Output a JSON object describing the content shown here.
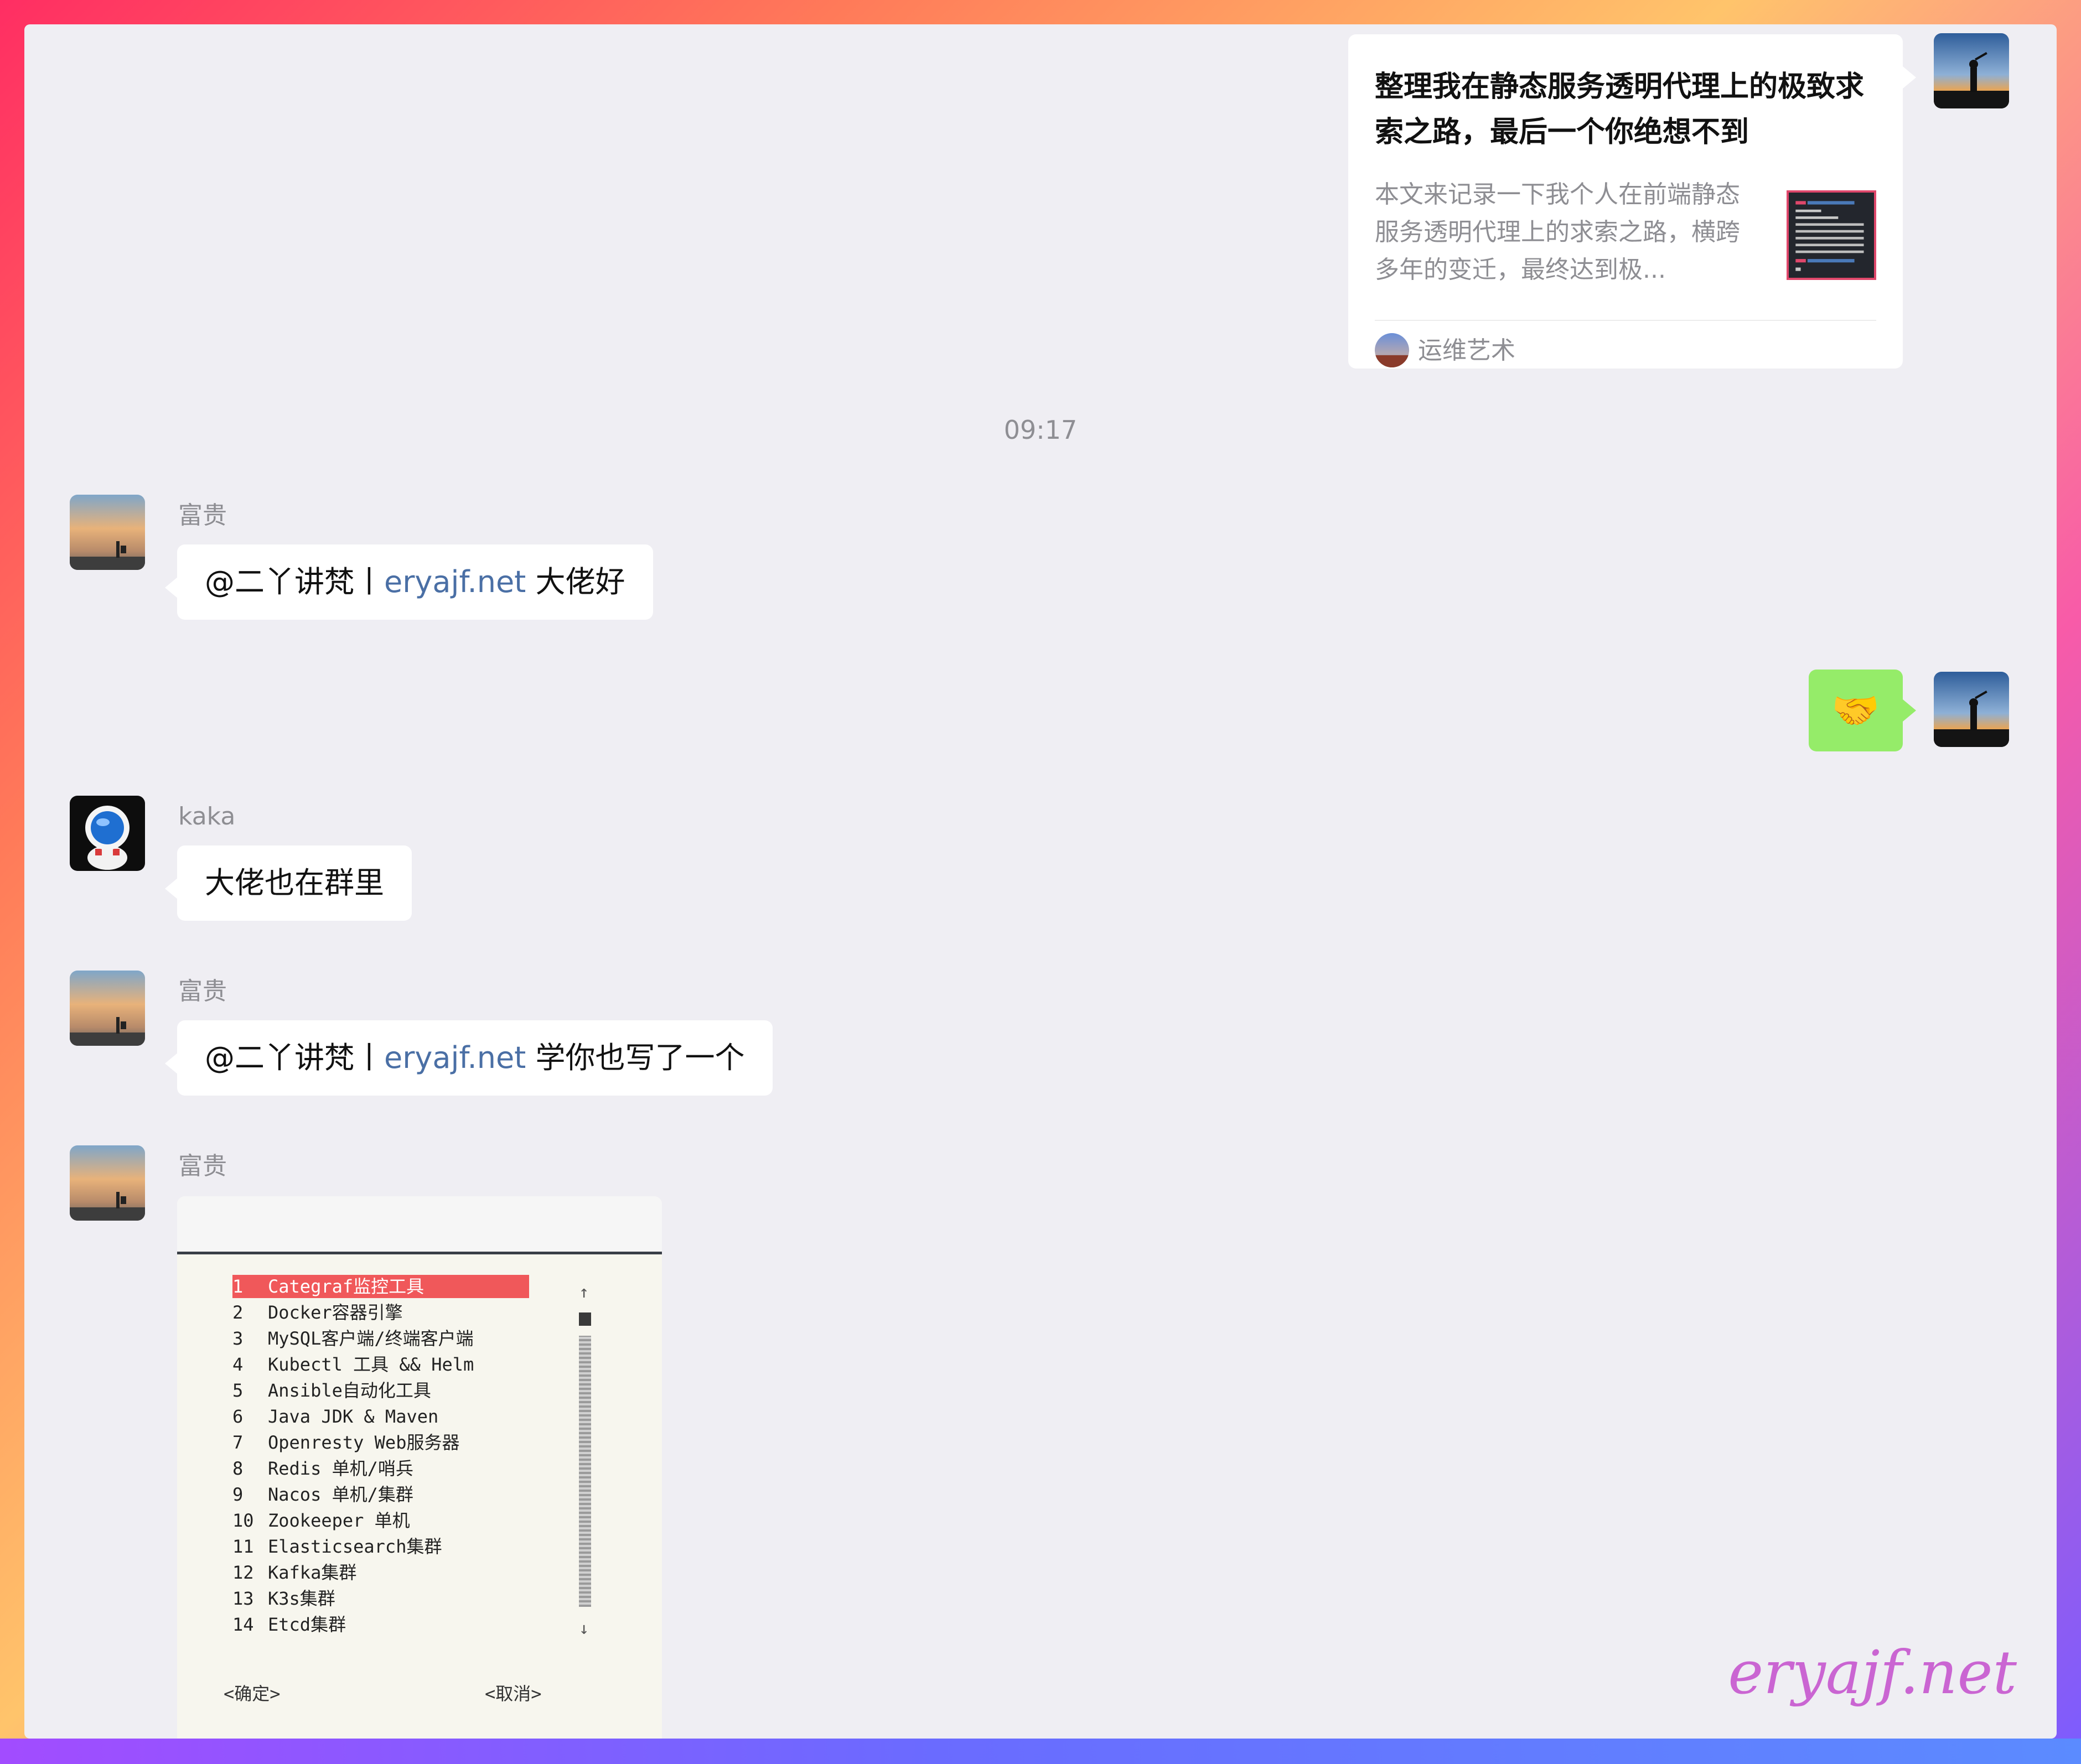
{
  "article_card": {
    "title": "整理我在静态服务透明代理上的极致求索之路，最后一个你绝想不到",
    "description": "本文来记录一下我个人在前端静态服务透明代理上的求索之路，横跨多年的变迁，最终达到极...",
    "source": "运维艺术"
  },
  "timestamp": "09:17",
  "messages": [
    {
      "sender": "富贵",
      "prefix": "@二丫讲梵丨",
      "link": "eryajf.net",
      "suffix": " 大佬好"
    },
    {
      "sender": "kaka",
      "text": "大佬也在群里"
    },
    {
      "sender": "富贵",
      "prefix": "@二丫讲梵丨",
      "link": "eryajf.net",
      "suffix": " 学你也写了一个"
    },
    {
      "sender": "富贵"
    }
  ],
  "self_sticker": "🤝",
  "terminal": {
    "menu": [
      {
        "num": "1",
        "label": "Categraf监控工具"
      },
      {
        "num": "2",
        "label": "Docker容器引擎"
      },
      {
        "num": "3",
        "label": "MySQL客户端/终端客户端"
      },
      {
        "num": "4",
        "label": "Kubectl 工具 && Helm"
      },
      {
        "num": "5",
        "label": "Ansible自动化工具"
      },
      {
        "num": "6",
        "label": "Java JDK & Maven"
      },
      {
        "num": "7",
        "label": "Openresty Web服务器"
      },
      {
        "num": "8",
        "label": "Redis 单机/哨兵"
      },
      {
        "num": "9",
        "label": "Nacos 单机/集群"
      },
      {
        "num": "10",
        "label": "Zookeeper 单机"
      },
      {
        "num": "11",
        "label": "Elasticsearch集群"
      },
      {
        "num": "12",
        "label": "Kafka集群"
      },
      {
        "num": "13",
        "label": "K3s集群"
      },
      {
        "num": "14",
        "label": "Etcd集群"
      }
    ],
    "ok_button": "<确定>",
    "cancel_button": "<取消>",
    "scroll_up": "↑",
    "scroll_down": "↓"
  },
  "watermark": "eryajf.net",
  "colors": {
    "bubble_self": "#95ec69",
    "link": "#4a6fa5",
    "selected_row": "#f0585a"
  }
}
